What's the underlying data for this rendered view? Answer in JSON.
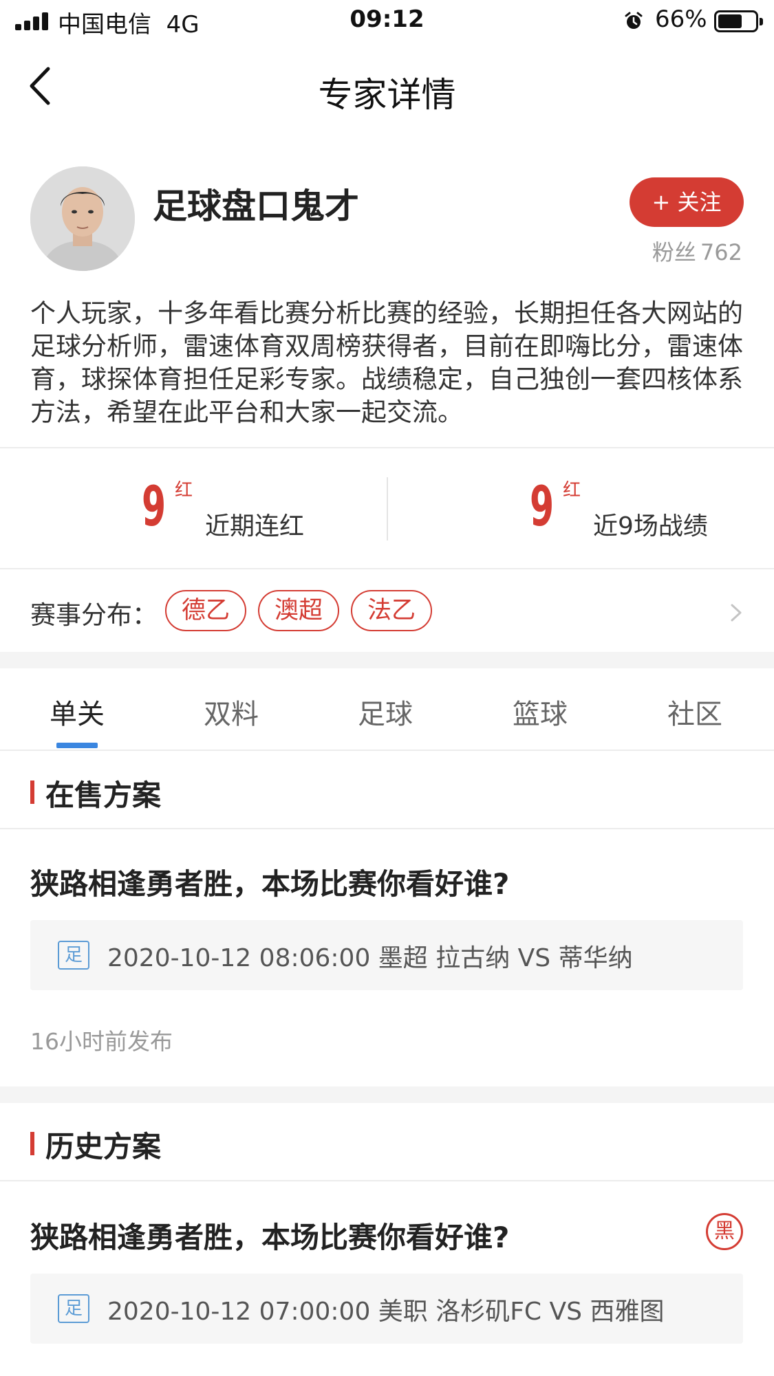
{
  "status_bar": {
    "carrier": "中国电信",
    "network": "4G",
    "time": "09:12",
    "battery_percent": "66%",
    "battery_level": 0.66
  },
  "nav": {
    "title": "专家详情"
  },
  "expert": {
    "name": "足球盘口鬼才",
    "follow_label": "+ 关注",
    "fans_label": "粉丝",
    "fans_count": "762",
    "bio": "个人玩家，十多年看比赛分析比赛的经验，长期担任各大网站的足球分析师，雷速体育双周榜获得者，目前在即嗨比分，雷速体育，球探体育担任足彩专家。战绩稳定，自己独创一套四核体系方法，希望在此平台和大家一起交流。"
  },
  "stats": [
    {
      "value": "9",
      "unit": "红",
      "label": "近期连红"
    },
    {
      "value": "9",
      "unit": "红",
      "label": "近9场战绩"
    }
  ],
  "leagues": {
    "label": "赛事分布：",
    "tags": [
      "德乙",
      "澳超",
      "法乙"
    ]
  },
  "tabs": [
    "单关",
    "双料",
    "足球",
    "篮球",
    "社区"
  ],
  "on_sale": {
    "section_title": "在售方案",
    "plans": [
      {
        "title": "狭路相逢勇者胜，本场比赛你看好谁?",
        "sport": "足",
        "match": "2020-10-12 08:06:00 墨超 拉古纳 VS 蒂华纳",
        "published": "16小时前发布"
      }
    ]
  },
  "history": {
    "section_title": "历史方案",
    "plans": [
      {
        "title": "狭路相逢勇者胜，本场比赛你看好谁?",
        "sport": "足",
        "match": "2020-10-12 07:00:00 美职 洛杉矶FC VS 西雅图",
        "result": "黑"
      }
    ]
  },
  "colors": {
    "accent_red": "#d43c33",
    "tab_indicator": "#3a86e0",
    "sport_tag": "#5b9bd5"
  }
}
